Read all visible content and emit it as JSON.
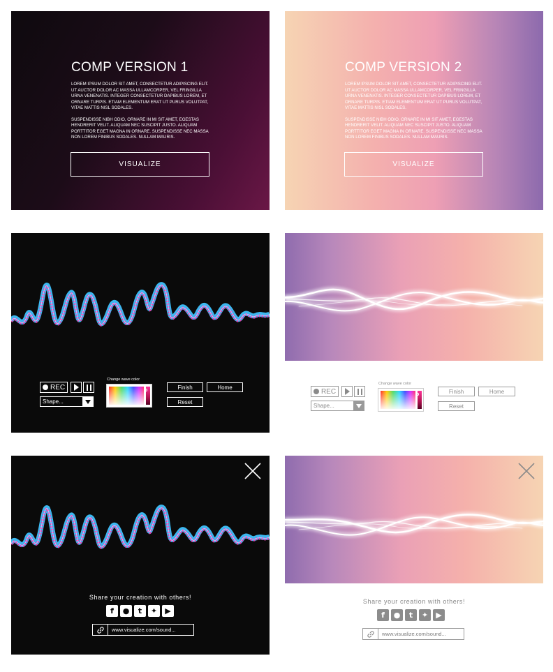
{
  "comp1": {
    "title": "COMP VERSION 1",
    "body_p1": "Lorem ipsum dolor sit amet, consectetur adipiscing elit. Ut auctor dolor ac massa ullamcorper, vel fringilla urna venenatis. Integer consectetur dapibus lorem, et ornare turpis. Etiam elementum erat ut purus volutpat, vitae mattis nisl sodales.",
    "body_p2": "Suspendisse nibh odio, ornare in mi sit amet, egestas hendrerit velit. Aliquam nec suscipit justo. Aliquam porttitor eget magna in ornare. Suspendisse nec massa non lorem finibus sodales. Nullam mauris.",
    "button": "VISUALIZE"
  },
  "comp2": {
    "title": "COMP VERSION 2",
    "body_p1": "Lorem ipsum dolor sit amet, consectetur adipiscing elit. Ut auctor dolor ac massa ullamcorper, vel fringilla urna venenatis. Integer consectetur dapibus lorem, et ornare turpis. Etiam elementum erat ut purus volutpat, vitae mattis nisl sodales.",
    "body_p2": "Suspendisse nibh odio, ornare in mi sit amet, egestas hendrerit velit. Aliquam nec suscipit justo. Aliquam porttitor eget magna in ornare. Suspendisse nec massa non lorem finibus sodales. Nullam mauris.",
    "button": "VISUALIZE"
  },
  "controls": {
    "rec": "REC",
    "shape": "Shape...",
    "color_label": "Change wave color",
    "finish": "Finish",
    "home": "Home",
    "reset": "Reset"
  },
  "share": {
    "text": "Share your creation with others!",
    "url": "www.visualize.com/sound...",
    "icons": [
      "facebook-icon",
      "reddit-icon",
      "tumblr-icon",
      "twitter-icon",
      "youtube-icon"
    ]
  },
  "colors": {
    "dark_bg": "#0a0a0a",
    "wave_pink": "#e040b0",
    "wave_blue": "#3bb8f0",
    "comp2_grad_start": "#f6d4b3",
    "comp2_grad_end": "#8c6aad"
  }
}
